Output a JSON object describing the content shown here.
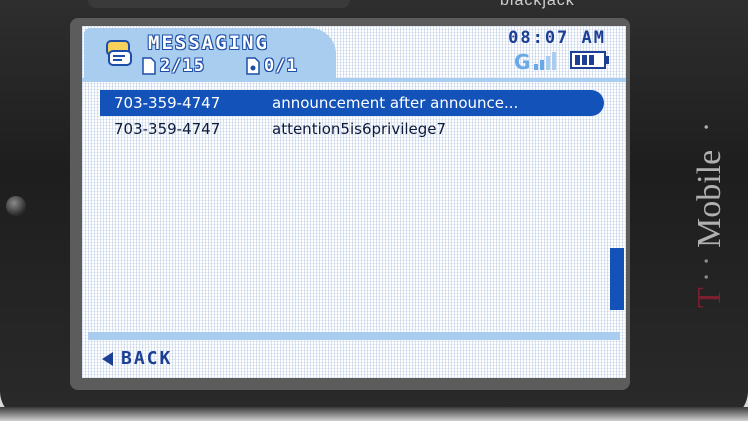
{
  "device": {
    "top_brand": "blackjack",
    "carrier_logo": "T · · Mobile ·"
  },
  "header": {
    "icon": "messaging-icon",
    "title": "MESSAGING",
    "sms_count": "2/15",
    "mms_count": "0/1",
    "time": "08:07 AM",
    "signal_icon": "signal-strength-icon",
    "battery_icon": "battery-icon"
  },
  "messages": [
    {
      "number": "703-359-4747",
      "subject": "announcement after announce...",
      "selected": true
    },
    {
      "number": "703-359-4747",
      "subject": "attention5is6privilege7",
      "selected": false
    }
  ],
  "footer": {
    "back_label": "BACK"
  },
  "colors": {
    "accent": "#1352b8",
    "header_bg": "#a9cdee",
    "text_dark": "#1c3f95"
  }
}
